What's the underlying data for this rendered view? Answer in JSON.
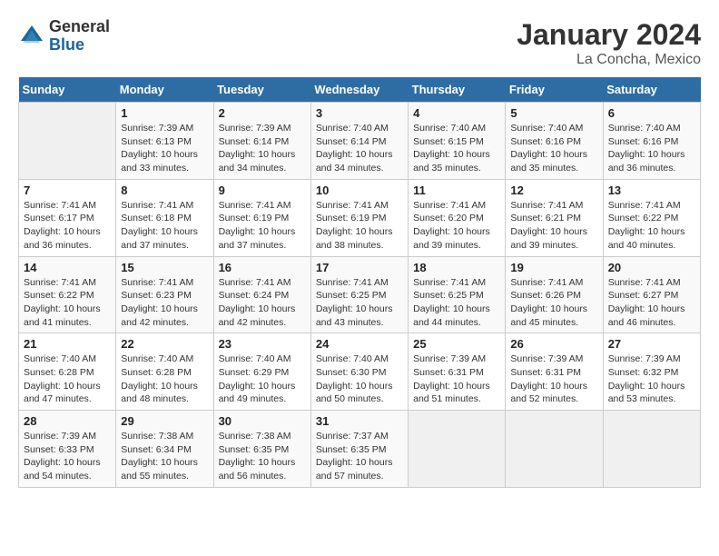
{
  "logo": {
    "general": "General",
    "blue": "Blue"
  },
  "title": "January 2024",
  "subtitle": "La Concha, Mexico",
  "days_header": [
    "Sunday",
    "Monday",
    "Tuesday",
    "Wednesday",
    "Thursday",
    "Friday",
    "Saturday"
  ],
  "weeks": [
    [
      {
        "day": "",
        "info": ""
      },
      {
        "day": "1",
        "info": "Sunrise: 7:39 AM\nSunset: 6:13 PM\nDaylight: 10 hours\nand 33 minutes."
      },
      {
        "day": "2",
        "info": "Sunrise: 7:39 AM\nSunset: 6:14 PM\nDaylight: 10 hours\nand 34 minutes."
      },
      {
        "day": "3",
        "info": "Sunrise: 7:40 AM\nSunset: 6:14 PM\nDaylight: 10 hours\nand 34 minutes."
      },
      {
        "day": "4",
        "info": "Sunrise: 7:40 AM\nSunset: 6:15 PM\nDaylight: 10 hours\nand 35 minutes."
      },
      {
        "day": "5",
        "info": "Sunrise: 7:40 AM\nSunset: 6:16 PM\nDaylight: 10 hours\nand 35 minutes."
      },
      {
        "day": "6",
        "info": "Sunrise: 7:40 AM\nSunset: 6:16 PM\nDaylight: 10 hours\nand 36 minutes."
      }
    ],
    [
      {
        "day": "7",
        "info": "Sunrise: 7:41 AM\nSunset: 6:17 PM\nDaylight: 10 hours\nand 36 minutes."
      },
      {
        "day": "8",
        "info": "Sunrise: 7:41 AM\nSunset: 6:18 PM\nDaylight: 10 hours\nand 37 minutes."
      },
      {
        "day": "9",
        "info": "Sunrise: 7:41 AM\nSunset: 6:19 PM\nDaylight: 10 hours\nand 37 minutes."
      },
      {
        "day": "10",
        "info": "Sunrise: 7:41 AM\nSunset: 6:19 PM\nDaylight: 10 hours\nand 38 minutes."
      },
      {
        "day": "11",
        "info": "Sunrise: 7:41 AM\nSunset: 6:20 PM\nDaylight: 10 hours\nand 39 minutes."
      },
      {
        "day": "12",
        "info": "Sunrise: 7:41 AM\nSunset: 6:21 PM\nDaylight: 10 hours\nand 39 minutes."
      },
      {
        "day": "13",
        "info": "Sunrise: 7:41 AM\nSunset: 6:22 PM\nDaylight: 10 hours\nand 40 minutes."
      }
    ],
    [
      {
        "day": "14",
        "info": "Sunrise: 7:41 AM\nSunset: 6:22 PM\nDaylight: 10 hours\nand 41 minutes."
      },
      {
        "day": "15",
        "info": "Sunrise: 7:41 AM\nSunset: 6:23 PM\nDaylight: 10 hours\nand 42 minutes."
      },
      {
        "day": "16",
        "info": "Sunrise: 7:41 AM\nSunset: 6:24 PM\nDaylight: 10 hours\nand 42 minutes."
      },
      {
        "day": "17",
        "info": "Sunrise: 7:41 AM\nSunset: 6:25 PM\nDaylight: 10 hours\nand 43 minutes."
      },
      {
        "day": "18",
        "info": "Sunrise: 7:41 AM\nSunset: 6:25 PM\nDaylight: 10 hours\nand 44 minutes."
      },
      {
        "day": "19",
        "info": "Sunrise: 7:41 AM\nSunset: 6:26 PM\nDaylight: 10 hours\nand 45 minutes."
      },
      {
        "day": "20",
        "info": "Sunrise: 7:41 AM\nSunset: 6:27 PM\nDaylight: 10 hours\nand 46 minutes."
      }
    ],
    [
      {
        "day": "21",
        "info": "Sunrise: 7:40 AM\nSunset: 6:28 PM\nDaylight: 10 hours\nand 47 minutes."
      },
      {
        "day": "22",
        "info": "Sunrise: 7:40 AM\nSunset: 6:28 PM\nDaylight: 10 hours\nand 48 minutes."
      },
      {
        "day": "23",
        "info": "Sunrise: 7:40 AM\nSunset: 6:29 PM\nDaylight: 10 hours\nand 49 minutes."
      },
      {
        "day": "24",
        "info": "Sunrise: 7:40 AM\nSunset: 6:30 PM\nDaylight: 10 hours\nand 50 minutes."
      },
      {
        "day": "25",
        "info": "Sunrise: 7:39 AM\nSunset: 6:31 PM\nDaylight: 10 hours\nand 51 minutes."
      },
      {
        "day": "26",
        "info": "Sunrise: 7:39 AM\nSunset: 6:31 PM\nDaylight: 10 hours\nand 52 minutes."
      },
      {
        "day": "27",
        "info": "Sunrise: 7:39 AM\nSunset: 6:32 PM\nDaylight: 10 hours\nand 53 minutes."
      }
    ],
    [
      {
        "day": "28",
        "info": "Sunrise: 7:39 AM\nSunset: 6:33 PM\nDaylight: 10 hours\nand 54 minutes."
      },
      {
        "day": "29",
        "info": "Sunrise: 7:38 AM\nSunset: 6:34 PM\nDaylight: 10 hours\nand 55 minutes."
      },
      {
        "day": "30",
        "info": "Sunrise: 7:38 AM\nSunset: 6:35 PM\nDaylight: 10 hours\nand 56 minutes."
      },
      {
        "day": "31",
        "info": "Sunrise: 7:37 AM\nSunset: 6:35 PM\nDaylight: 10 hours\nand 57 minutes."
      },
      {
        "day": "",
        "info": ""
      },
      {
        "day": "",
        "info": ""
      },
      {
        "day": "",
        "info": ""
      }
    ]
  ]
}
